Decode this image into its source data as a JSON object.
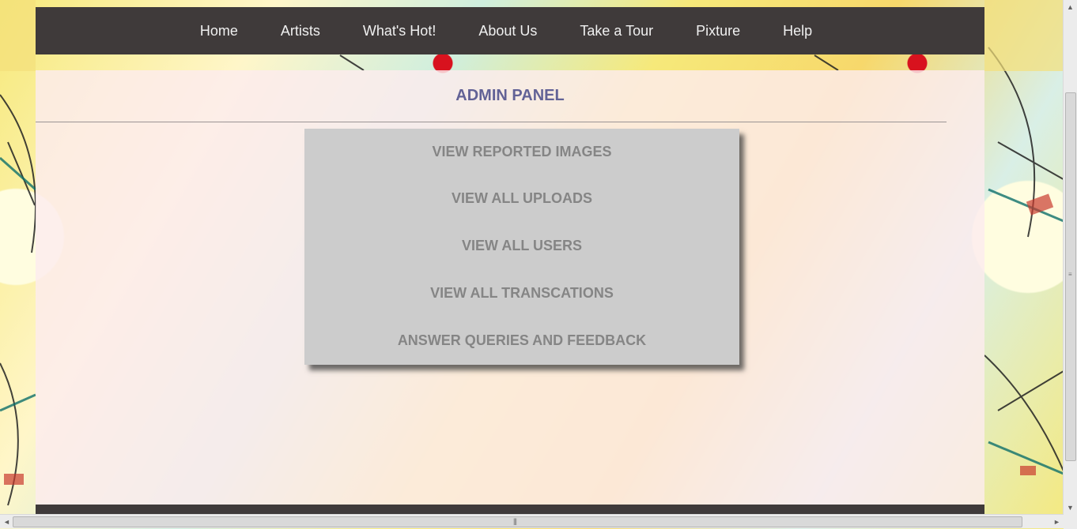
{
  "nav": {
    "items": [
      {
        "label": "Home"
      },
      {
        "label": "Artists"
      },
      {
        "label": "What's Hot!"
      },
      {
        "label": "About Us"
      },
      {
        "label": "Take a Tour"
      },
      {
        "label": "Pixture"
      },
      {
        "label": "Help"
      }
    ]
  },
  "main": {
    "title": "ADMIN PANEL",
    "menu": [
      {
        "label": "VIEW REPORTED IMAGES"
      },
      {
        "label": "VIEW ALL UPLOADS"
      },
      {
        "label": "VIEW ALL USERS"
      },
      {
        "label": "VIEW ALL TRANSCATIONS"
      },
      {
        "label": "ANSWER QUERIES AND FEEDBACK"
      }
    ]
  },
  "scrollbars": {
    "up_arrow": "▲",
    "down_arrow": "▼",
    "left_arrow": "◄",
    "right_arrow": "►",
    "vertical_grip": "≡",
    "horizontal_grip": "|||"
  },
  "colors": {
    "nav_bg": "#3f3a3a",
    "title": "#626296",
    "menu_bg": "#cccccc",
    "menu_text": "#858585"
  }
}
